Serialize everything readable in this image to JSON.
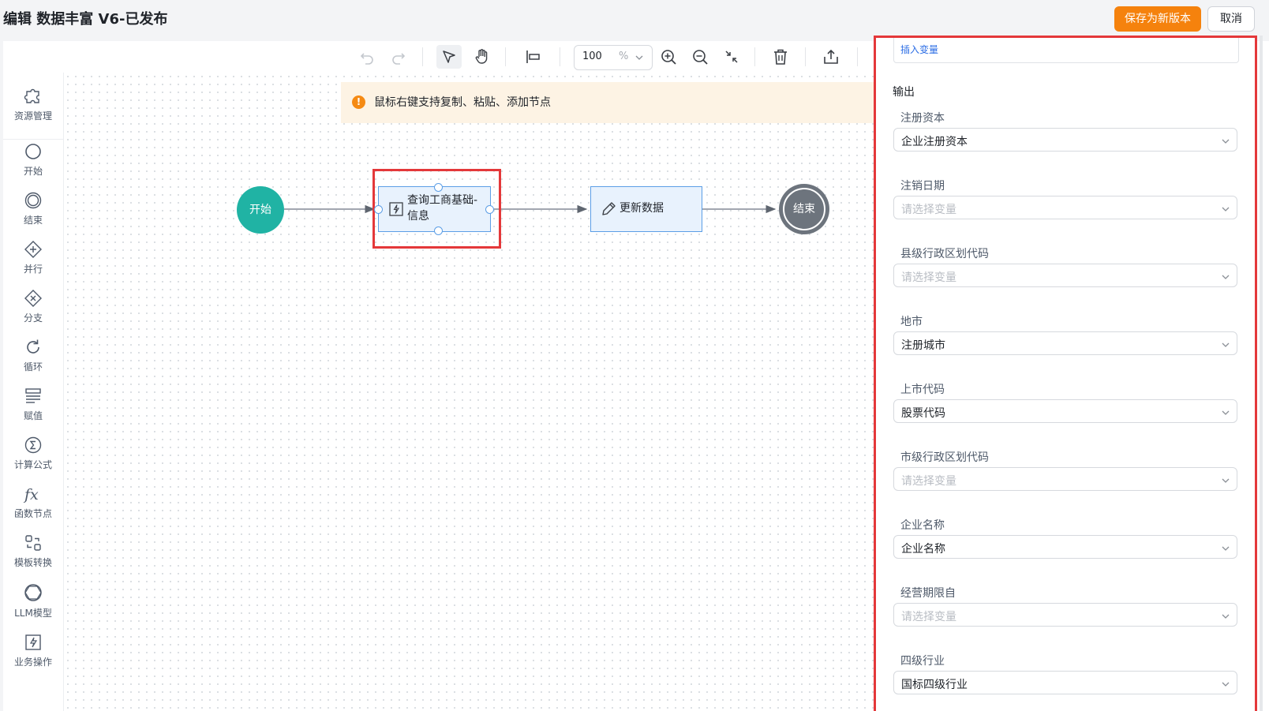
{
  "header": {
    "title": "编辑 数据丰富 V6-已发布",
    "save_label": "保存为新版本",
    "cancel_label": "取消"
  },
  "toolbar": {
    "zoom_value": "100",
    "zoom_unit": "%",
    "icons": [
      "undo-icon",
      "redo-icon",
      "select-pointer-icon",
      "hand-pan-icon",
      "align-left-icon",
      "zoom-in-icon",
      "zoom-out-icon",
      "fit-shrink-icon",
      "delete-icon",
      "export-icon"
    ]
  },
  "sidebar": {
    "items": [
      {
        "label": "资源管理",
        "icon": "puzzle-icon"
      },
      {
        "label": "开始",
        "icon": "circle-icon"
      },
      {
        "label": "结束",
        "icon": "double-circle-icon"
      },
      {
        "label": "并行",
        "icon": "diamond-plus-icon"
      },
      {
        "label": "分支",
        "icon": "diamond-x-icon"
      },
      {
        "label": "循环",
        "icon": "loop-icon"
      },
      {
        "label": "赋值",
        "icon": "assign-icon"
      },
      {
        "label": "计算公式",
        "icon": "sigma-icon"
      },
      {
        "label": "函数节点",
        "icon": "fx-icon"
      },
      {
        "label": "模板转换",
        "icon": "template-icon"
      },
      {
        "label": "LLM模型",
        "icon": "llm-icon"
      },
      {
        "label": "业务操作",
        "icon": "business-icon"
      }
    ]
  },
  "canvas": {
    "notice": "鼠标右键支持复制、粘贴、添加节点",
    "notice_icon": "!",
    "nodes": {
      "start": "开始",
      "query_line1": "查询工商基础-",
      "query_line2": "信息",
      "update": "更新数据",
      "end": "结束"
    }
  },
  "panel": {
    "insert_variable": "插入变量",
    "output_title": "输出",
    "placeholder": "请选择变量",
    "fields": [
      {
        "label": "注册资本",
        "value": "企业注册资本"
      },
      {
        "label": "注销日期",
        "value": ""
      },
      {
        "label": "县级行政区划代码",
        "value": ""
      },
      {
        "label": "地市",
        "value": "注册城市"
      },
      {
        "label": "上市代码",
        "value": "股票代码"
      },
      {
        "label": "市级行政区划代码",
        "value": ""
      },
      {
        "label": "企业名称",
        "value": "企业名称"
      },
      {
        "label": "经营期限自",
        "value": ""
      },
      {
        "label": "四级行业",
        "value": "国标四级行业"
      }
    ]
  },
  "colors": {
    "accent_orange": "#f5820d",
    "start_node": "#20b3a4",
    "end_node": "#6d747d",
    "highlight_red": "#e4383a",
    "link_blue": "#2b6de5"
  }
}
